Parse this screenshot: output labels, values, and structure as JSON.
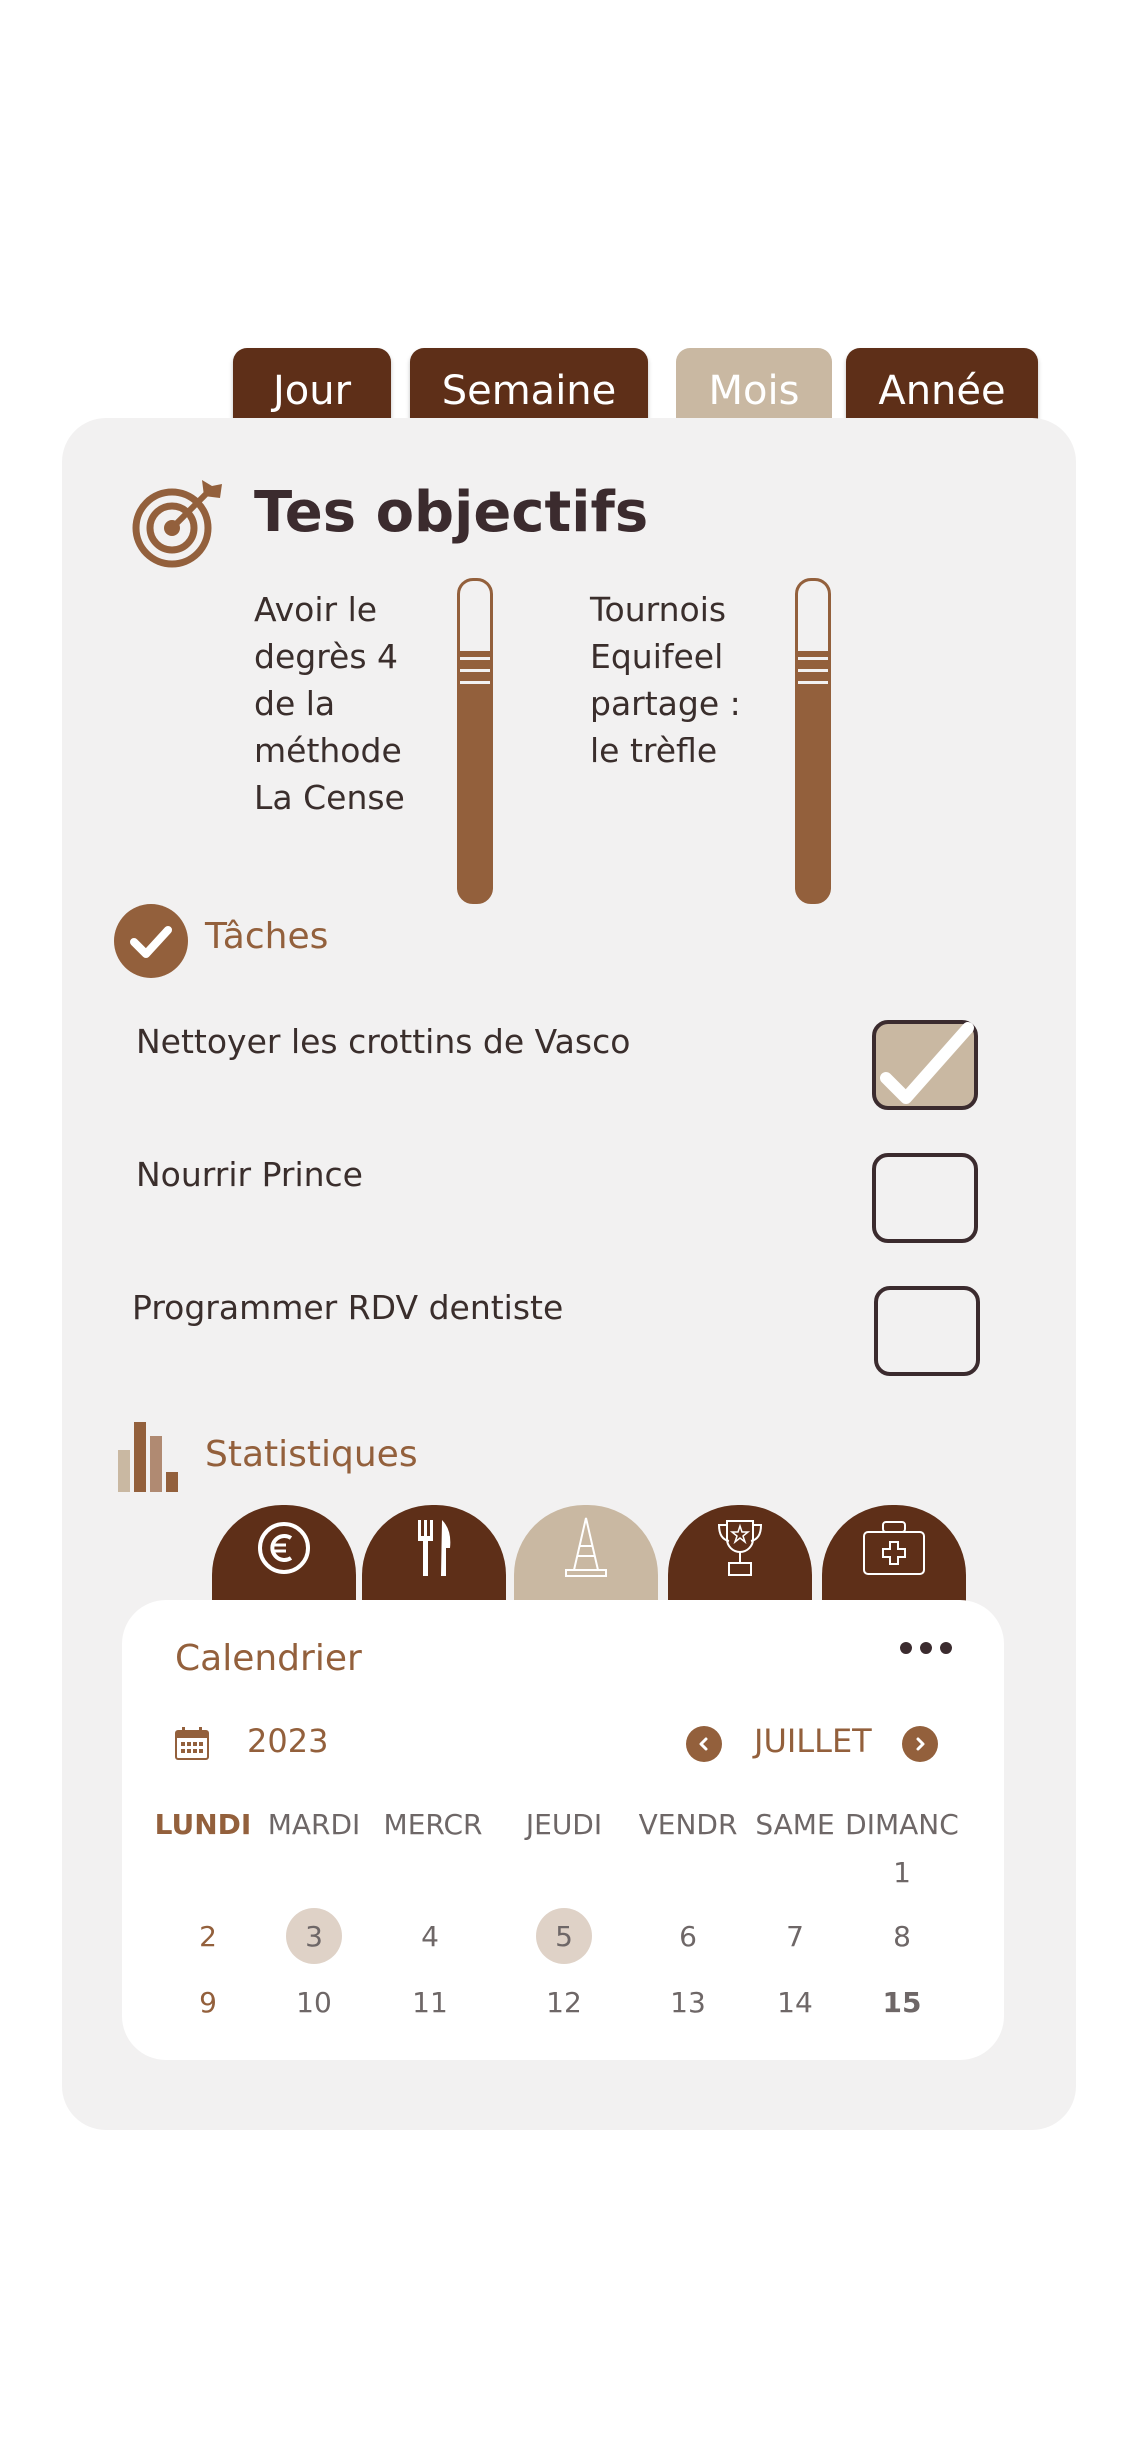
{
  "period_tabs": [
    {
      "label": "Jour",
      "active": false
    },
    {
      "label": "Semaine",
      "active": false
    },
    {
      "label": "Mois",
      "active": true
    },
    {
      "label": "Année",
      "active": false
    }
  ],
  "goals": {
    "title": "Tes objectifs",
    "icon": "target-arrow-icon",
    "items": [
      {
        "lines": [
          "Avoir le",
          "degrès 4",
          "de la",
          "méthode",
          "La Cense"
        ],
        "progress": 0.78
      },
      {
        "lines": [
          "Tournois",
          "Equifeel",
          "partage :",
          "le trèfle"
        ],
        "progress": 0.78
      }
    ]
  },
  "tasks": {
    "title": "Tâches",
    "icon": "check-circle-icon",
    "items": [
      {
        "label": "Nettoyer les crottins de Vasco",
        "done": true
      },
      {
        "label": "Nourrir Prince",
        "done": false
      },
      {
        "label": "Programmer RDV dentiste",
        "done": false
      }
    ]
  },
  "statistics": {
    "title": "Statistiques",
    "icon": "bar-chart-icon",
    "tabs": [
      {
        "icon": "euro-icon",
        "active": false
      },
      {
        "icon": "fork-knife-icon",
        "active": false
      },
      {
        "icon": "cone-icon",
        "active": true
      },
      {
        "icon": "trophy-icon",
        "active": false
      },
      {
        "icon": "first-aid-kit-icon",
        "active": false
      }
    ]
  },
  "calendar": {
    "title": "Calendrier",
    "menu_icon": "more-horizontal-icon",
    "year_icon": "calendar-icon",
    "year": "2023",
    "month": "JUILLET",
    "weekdays": [
      "LUNDI",
      "MARDI",
      "MERCR",
      "JEUDI",
      "VENDR",
      "SAME",
      "DIMANC"
    ],
    "weeks": [
      [
        "",
        "",
        "",
        "",
        "",
        "",
        "1"
      ],
      [
        "2",
        "3",
        "4",
        "5",
        "6",
        "7",
        "8"
      ],
      [
        "9",
        "10",
        "11",
        "12",
        "13",
        "14",
        "15"
      ]
    ],
    "highlighted_days": [
      "3",
      "5"
    ],
    "today": "15",
    "colors": {
      "accent": "#93603c",
      "dark": "#5e2f18",
      "beige": "#c9b8a2",
      "highlight": "#dfd2c7"
    }
  }
}
